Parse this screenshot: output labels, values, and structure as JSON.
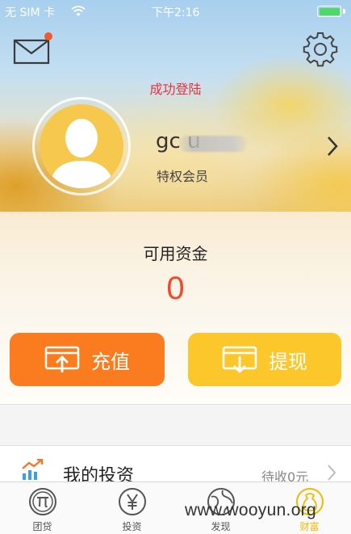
{
  "status_bar": {
    "carrier": "无 SIM 卡",
    "wifi_icon": "wifi-icon",
    "time": "下午2:16",
    "battery_color": "#4cd964"
  },
  "header": {
    "mail_icon": "envelope-icon",
    "settings_icon": "gear-icon",
    "login_status": "成功登陆"
  },
  "profile": {
    "avatar_icon": "default-user-avatar",
    "username": "gc  u",
    "member_level": "特权会员"
  },
  "funds": {
    "label": "可用资金",
    "value": "0"
  },
  "actions": {
    "recharge_label": "充值",
    "withdraw_label": "提现"
  },
  "investments": {
    "title": "我的投资",
    "pending": "待收0元"
  },
  "tabbar": {
    "items": [
      {
        "label": "团贷",
        "icon": "pi-icon"
      },
      {
        "label": "投资",
        "icon": "yen-icon"
      },
      {
        "label": "发现",
        "icon": "globe-icon"
      },
      {
        "label": "财富",
        "icon": "wealth-icon",
        "active": true
      }
    ]
  },
  "watermark": "www.wooyun.org",
  "colors": {
    "accent_red": "#e8323c",
    "recharge_orange": "#fa7c1f",
    "withdraw_yellow": "#fcc72a",
    "active_tab": "#f5b800"
  }
}
